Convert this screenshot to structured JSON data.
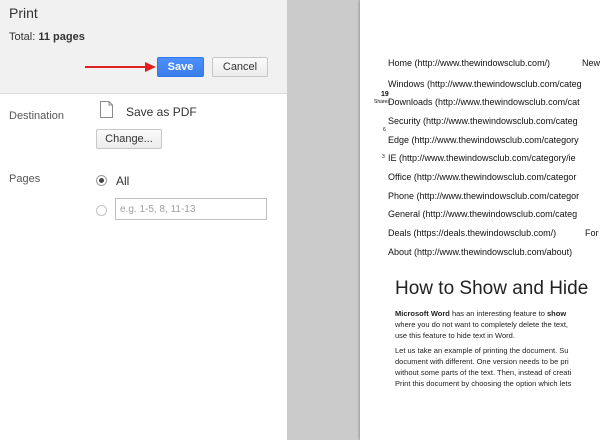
{
  "dialog": {
    "title": "Print",
    "total_label": "Total:",
    "total_value": "11 pages",
    "save_label": "Save",
    "cancel_label": "Cancel"
  },
  "destination": {
    "label": "Destination",
    "value": "Save as PDF",
    "change_label": "Change..."
  },
  "pages": {
    "label": "Pages",
    "all_label": "All",
    "selected": "All",
    "custom_placeholder": "e.g. 1-5, 8, 11-13"
  },
  "preview": {
    "menu": [
      "Home (http://www.thewindowsclub.com/)",
      "Windows (http://www.thewindowsclub.com/categ",
      "Downloads (http://www.thewindowsclub.com/cat",
      "Security (http://www.thewindowsclub.com/categ",
      "Edge (http://www.thewindowsclub.com/category",
      "IE (http://www.thewindowsclub.com/category/ie",
      "Office (http://www.thewindowsclub.com/categor",
      "Phone (http://www.thewindowsclub.com/categor",
      "General (http://www.thewindowsclub.com/categ",
      "Deals (https://deals.thewindowsclub.com/)",
      "About (http://www.thewindowsclub.com/about)"
    ],
    "menu_right_1": "New",
    "menu_right_2": "For",
    "share_count": "19",
    "share_label": "Shares",
    "share_mini_1": "6",
    "share_mini_2": "3",
    "article_title": "How to Show and Hide",
    "p1_bold": "Microsoft Word",
    "p1_a": " has an interesting feature to ",
    "p1_bold2": "show",
    "p1_line2": "where you do not want to completely delete the text,",
    "p1_line3": "use this feature to hide text in Word.",
    "p2_line1": "Let us take an example of printing the document. Su",
    "p2_line2": "document with different. One version needs to be pri",
    "p2_line3": "without some parts of the text. Then, instead of creati",
    "p2_line4": "Print this document by choosing the option which lets"
  },
  "colors": {
    "primary_button": "#4d90fe",
    "arrow": "#e02020",
    "preview_background": "#cbcbcb"
  }
}
